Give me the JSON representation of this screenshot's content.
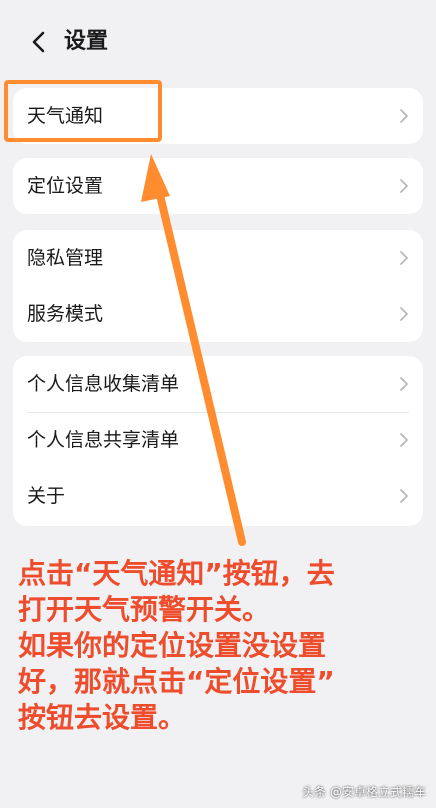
{
  "header": {
    "title": "设置"
  },
  "groups": [
    {
      "items": [
        {
          "label": "天气通知"
        }
      ]
    },
    {
      "items": [
        {
          "label": "定位设置"
        }
      ]
    },
    {
      "items": [
        {
          "label": "隐私管理"
        },
        {
          "label": "服务模式"
        }
      ]
    },
    {
      "items": [
        {
          "label": "个人信息收集清单"
        },
        {
          "label": "个人信息共享清单"
        },
        {
          "label": "关于"
        }
      ]
    }
  ],
  "annotation": {
    "lines": [
      "点击“天气通知”按钮，去",
      "打开天气预警开关。",
      "如果你的定位设置没设置",
      "好，那就点击“定位设置”",
      "按钮去设置。"
    ],
    "color": "#ee4d2d",
    "highlight_color": "#ff8c2e"
  },
  "watermark": "头条 @安卓格立式糯车"
}
